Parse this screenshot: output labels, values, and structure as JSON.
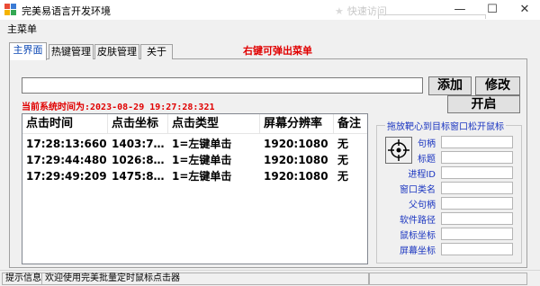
{
  "window": {
    "title": "完美易语言开发环境"
  },
  "background_ghost": {
    "text": "快速访问"
  },
  "controls": {
    "minimize": "—",
    "maximize": "☐",
    "close": "✕"
  },
  "menu": {
    "main": "主菜单"
  },
  "tabs": [
    "主界面",
    "热键管理",
    "皮肤管理",
    "关于"
  ],
  "hint": "右键可弹出菜单",
  "input_value": "",
  "buttons": {
    "add": "添加",
    "modify": "修改",
    "start": "开启"
  },
  "current_time": "当前系统时间为:2023-08-29 19:27:28:321",
  "table": {
    "headers": [
      "点击时间",
      "点击坐标",
      "点击类型",
      "屏幕分辨率",
      "备注"
    ],
    "rows": [
      [
        "17:28:13:660",
        "1403:7…",
        "1=左键单击",
        "1920:1080",
        "无"
      ],
      [
        "17:29:44:480",
        "1026:8…",
        "1=左键单击",
        "1920:1080",
        "无"
      ],
      [
        "17:29:49:209",
        "1475:8…",
        "1=左键单击",
        "1920:1080",
        "无"
      ]
    ]
  },
  "group": {
    "title": "拖放靶心到目标窗口松开鼠标",
    "fields": [
      "句柄",
      "标题",
      "进程ID",
      "窗口类名",
      "父句柄",
      "软件路径",
      "鼠标坐标",
      "屏幕坐标"
    ]
  },
  "status": {
    "label": "提示信息",
    "message": "欢迎使用完美批量定时鼠标点击器"
  }
}
